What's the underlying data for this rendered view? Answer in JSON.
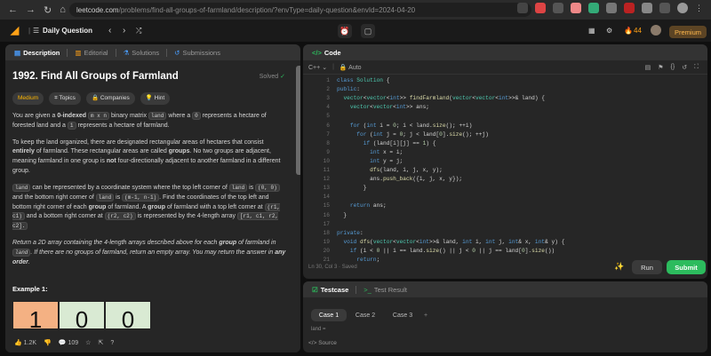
{
  "browser": {
    "url_host": "leetcode.com",
    "url_path": "/problems/find-all-groups-of-farmland/description/?envType=daily-question&envId=2024-04-20"
  },
  "appbar": {
    "daily_question": "Daily Question",
    "streak": "44",
    "premium": "Premium"
  },
  "left_tabs": [
    "Description",
    "Editorial",
    "Solutions",
    "Submissions"
  ],
  "problem": {
    "title": "1992. Find All Groups of Farmland",
    "solved": "Solved",
    "difficulty": "Medium",
    "chips": [
      "Topics",
      "Companies",
      "Hint"
    ],
    "p1_a": "You are given a ",
    "p1_b": "0-indexed",
    "p1_c": "m x n",
    "p1_d": " binary matrix ",
    "p1_e": "land",
    "p1_f": " where a ",
    "p1_g": "0",
    "p1_h": " represents a hectare of forested land and a ",
    "p1_i": "1",
    "p1_j": " represents a hectare of farmland.",
    "p2_a": "To keep the land organized, there are designated rectangular areas of hectares that consist ",
    "p2_b": "entirely",
    "p2_c": " of farmland. These rectangular areas are called ",
    "p2_d": "groups",
    "p2_e": ". No two groups are adjacent, meaning farmland in one group is ",
    "p2_f": "not",
    "p2_g": " four-directionally adjacent to another farmland in a different group.",
    "p3_a": "land",
    "p3_b": " can be represented by a coordinate system where the top left corner of ",
    "p3_c": "land",
    "p3_d": " is ",
    "p3_e": "(0, 0)",
    "p3_f": " and the bottom right corner of ",
    "p3_g": "land",
    "p3_h": " is ",
    "p3_i": "(m-1, n-1)",
    "p3_j": ". Find the coordinates of the top left and bottom right corner of each ",
    "p3_k": "group",
    "p3_l": " of farmland. A ",
    "p3_m": "group",
    "p3_n": " of farmland with a top left corner at ",
    "p3_o": "(r1, c1)",
    "p3_p": " and a bottom right corner at ",
    "p3_q": "(r2, c2)",
    "p3_r": " is represented by the 4-length array ",
    "p3_s": "[r1, c1, r2, c2].",
    "p4_a": "Return a 2D array containing the 4-length arrays described above for each ",
    "p4_b": "group",
    "p4_c": " of farmland in ",
    "p4_d": "land",
    "p4_e": ". If there are no groups of farmland, return an empty array. You may return the answer in ",
    "p4_f": "any order",
    "p4_g": ".",
    "example_title": "Example 1:",
    "grid": [
      "1",
      "0",
      "0"
    ]
  },
  "left_status": {
    "likes": "1.2K",
    "comments": "109"
  },
  "code_panel": {
    "title": "Code",
    "language": "C++",
    "mode": "Auto",
    "cursor": "Ln 30, Col 3",
    "saved": "Saved",
    "run": "Run",
    "submit": "Submit"
  },
  "code_lines": [
    "class Solution {",
    "public:",
    "  vector<vector<int>> findFarmland(vector<vector<int>>& land) {",
    "    vector<vector<int>> ans;",
    "",
    "    for (int i = 0; i < land.size(); ++i)",
    "      for (int j = 0; j < land[0].size(); ++j)",
    "        if (land[i][j] == 1) {",
    "          int x = i;",
    "          int y = j;",
    "          dfs(land, i, j, x, y);",
    "          ans.push_back({i, j, x, y});",
    "        }",
    "",
    "    return ans;",
    "  }",
    "",
    "private:",
    "  void dfs(vector<vector<int>>& land, int i, int j, int& x, int& y) {",
    "    if (i < 0 || i == land.size() || j < 0 || j == land[0].size())",
    "      return;"
  ],
  "testcase_panel": {
    "tab_testcase": "Testcase",
    "tab_result": "Test Result",
    "cases": [
      "Case 1",
      "Case 2",
      "Case 3"
    ],
    "var_label": "land =",
    "source": "Source"
  }
}
